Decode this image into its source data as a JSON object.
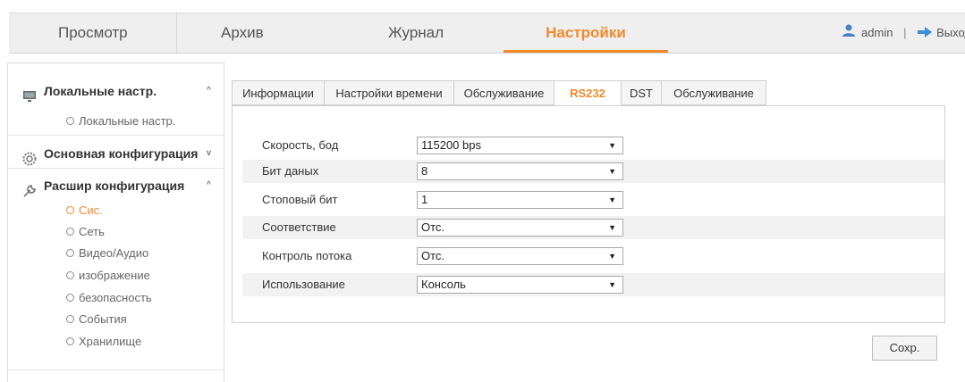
{
  "nav": {
    "tabs": [
      {
        "label": "Просмотр"
      },
      {
        "label": "Архив"
      },
      {
        "label": "Журнал"
      },
      {
        "label": "Настройки"
      }
    ],
    "active_tab": "Настройки",
    "user": "admin",
    "separator": "|",
    "logout": "Выход",
    "user_icon": "user-icon",
    "logout_icon": "logout-icon",
    "accent_color": "#f08a2c"
  },
  "sidebar": {
    "local": {
      "label": "Локальные настр.",
      "caret": "^",
      "icon": "monitor-icon",
      "items": [
        "Локальные настр."
      ]
    },
    "basic": {
      "label": "Основная конфигурация",
      "caret": "v",
      "icon": "gear-icon"
    },
    "advanced": {
      "label": "Расшир конфигурация",
      "caret": "^",
      "icon": "wrench-icon",
      "items": [
        "Сис.",
        "Сеть",
        "Видео/Аудио",
        "изображение",
        "безопасность",
        "События",
        "Хранилище"
      ],
      "active_item": "Сис."
    }
  },
  "tabs": [
    {
      "label": "Информации"
    },
    {
      "label": "Настройки времени"
    },
    {
      "label": "Обслуживание"
    },
    {
      "label": "RS232"
    },
    {
      "label": "DST"
    },
    {
      "label": "Обслуживание"
    }
  ],
  "active_tab": "RS232",
  "form": [
    {
      "label": "Скорость, бод",
      "value": "115200 bps"
    },
    {
      "label": "Бит даных",
      "value": "8"
    },
    {
      "label": "Стоповый бит",
      "value": "1"
    },
    {
      "label": "Соответствие",
      "value": "Отс."
    },
    {
      "label": "Контроль потока",
      "value": "Отс."
    },
    {
      "label": "Использование",
      "value": "Консоль"
    }
  ],
  "dropdown_arrow": "▼",
  "save_label": "Сохр."
}
